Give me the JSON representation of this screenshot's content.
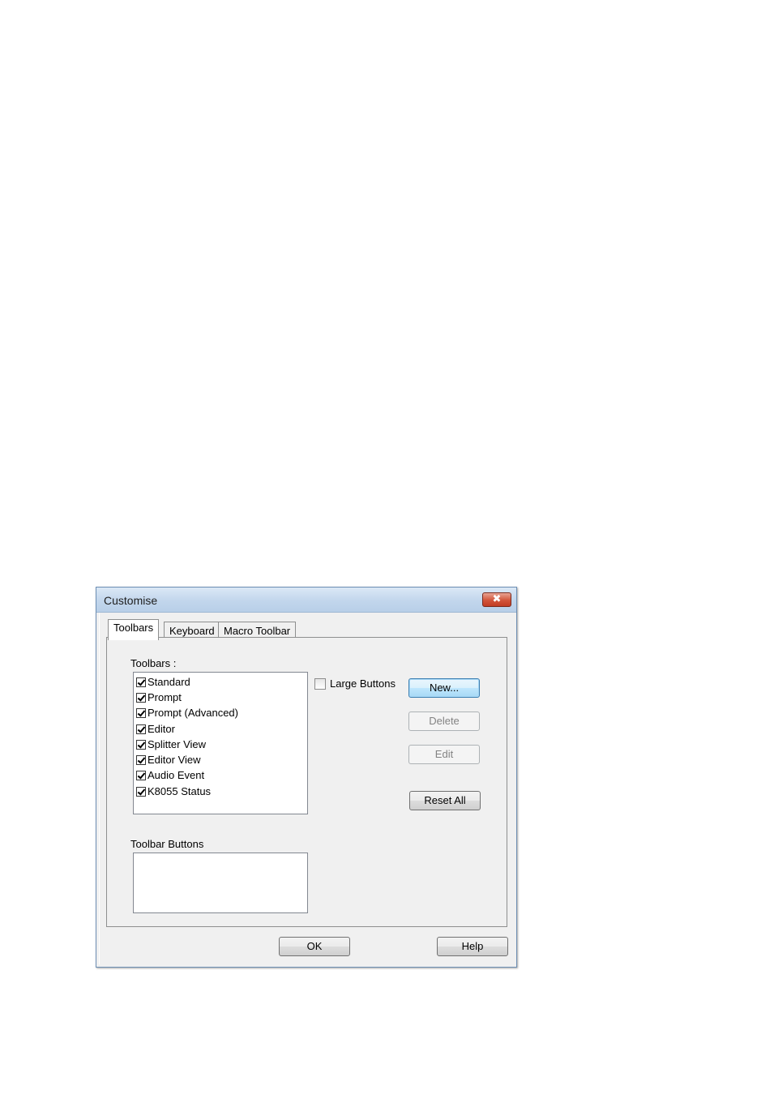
{
  "window": {
    "title": "Customise",
    "close_glyph": "✖"
  },
  "tabs": [
    {
      "label": "Toolbars",
      "active": true
    },
    {
      "label": "Keyboard",
      "active": false
    },
    {
      "label": "Macro Toolbar",
      "active": false
    }
  ],
  "toolbars_panel": {
    "toolbars_label": "Toolbars :",
    "toolbars": [
      {
        "label": "Standard",
        "checked": true
      },
      {
        "label": "Prompt",
        "checked": true
      },
      {
        "label": "Prompt (Advanced)",
        "checked": true
      },
      {
        "label": "Editor",
        "checked": true
      },
      {
        "label": "Splitter View",
        "checked": true
      },
      {
        "label": "Editor View",
        "checked": true
      },
      {
        "label": "Audio Event",
        "checked": true
      },
      {
        "label": "K8055 Status",
        "checked": true
      }
    ],
    "large_buttons_label": "Large Buttons",
    "large_buttons_checked": false,
    "toolbar_buttons_label": "Toolbar Buttons",
    "new_button": "New...",
    "delete_button": "Delete",
    "edit_button": "Edit",
    "reset_all_button": "Reset All"
  },
  "footer": {
    "ok_button": "OK",
    "help_button": "Help"
  },
  "colors": {
    "title_bar": "#c2d6ec",
    "close_button": "#d2543a",
    "focus_border": "#3c7fb1"
  }
}
